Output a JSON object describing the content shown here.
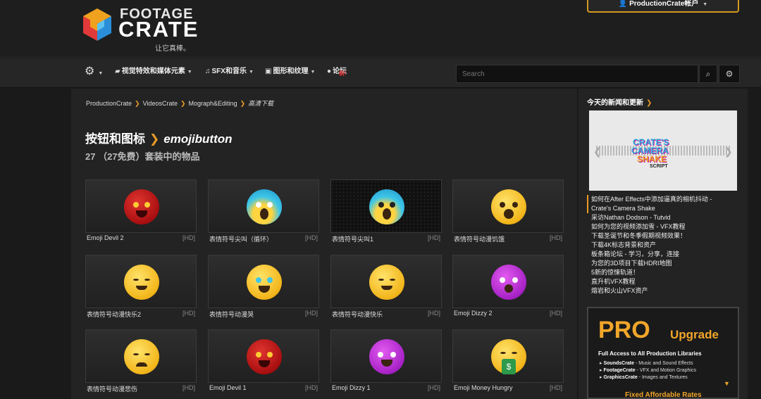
{
  "header": {
    "logo_line1": "FOOTAGE",
    "logo_line2": "CRATE",
    "logo_tagline": "让它真棒。",
    "account_label": "ProductionCrate帐户"
  },
  "nav": {
    "items": [
      {
        "label": "视觉特效和媒体元素"
      },
      {
        "label": "SFX和音乐"
      },
      {
        "label": "图形和纹理"
      },
      {
        "label": "论坛",
        "badge": "新!"
      }
    ],
    "search_placeholder": "Search"
  },
  "breadcrumb": {
    "items": [
      "ProductionCrate",
      "VideosCrate",
      "Mograph&Editing",
      "高清下载"
    ]
  },
  "page": {
    "category": "按钮和图标",
    "tag": "emojibutton",
    "subtitle": "27 （27免费）套装中的物品"
  },
  "grid": {
    "hd_label": "[HD]",
    "items": [
      {
        "caption": "Emoji Devil 2"
      },
      {
        "caption": "表情符号尖叫（循环）"
      },
      {
        "caption": "表情符号尖叫1"
      },
      {
        "caption": "表情符号动漫饥饿"
      },
      {
        "caption": "表情符号动漫快乐2"
      },
      {
        "caption": "表情符号动漫哭"
      },
      {
        "caption": "表情符号动漫快乐"
      },
      {
        "caption": "Emoji Dizzy 2"
      },
      {
        "caption": "表情符号动漫悲伤"
      },
      {
        "caption": "Emoji Devil 1"
      },
      {
        "caption": "Emoji Dizzy 1"
      },
      {
        "caption": "Emoji Money Hungry"
      }
    ]
  },
  "sidebar": {
    "title": "今天的新闻和更新",
    "feature": {
      "line1": "CRATE'S",
      "line2": "CAMERA",
      "line3": "SHAKE",
      "line4": "SCRIPT"
    },
    "news": [
      "如何在After Effects中添加逼真的相机抖动 -",
      "Crate's Camera Shake",
      "采访Nathan Dodson - Tutvid",
      "如何为您的视频添加雪 - VFX教程",
      "下载圣诞节和冬季假期视频效果！",
      "下载4K标志背景和资产",
      "板条箱论坛 - 学习，分享，连接",
      "为您的3D项目下载HDRI地图",
      "5新的惊悚轨道！",
      "直升机VFX教程",
      "熔岩和火山VFX资产"
    ],
    "promo": {
      "pro": "PRO",
      "upgrade": "Upgrade",
      "subtitle": "Full Access to All Production Libraries",
      "b1_name": "SoundsCrate",
      "b1_desc": "- Music and Sound Effects",
      "b2_name": "FootageCrate",
      "b2_desc": "- VFX and Motion Graphics",
      "b3_name": "GraphicsCrate",
      "b3_desc": "- Images and Textures",
      "footer": "Fixed Affordable Rates"
    }
  },
  "colors": {
    "accent": "#e89a24",
    "background": "#1a1a1a"
  }
}
